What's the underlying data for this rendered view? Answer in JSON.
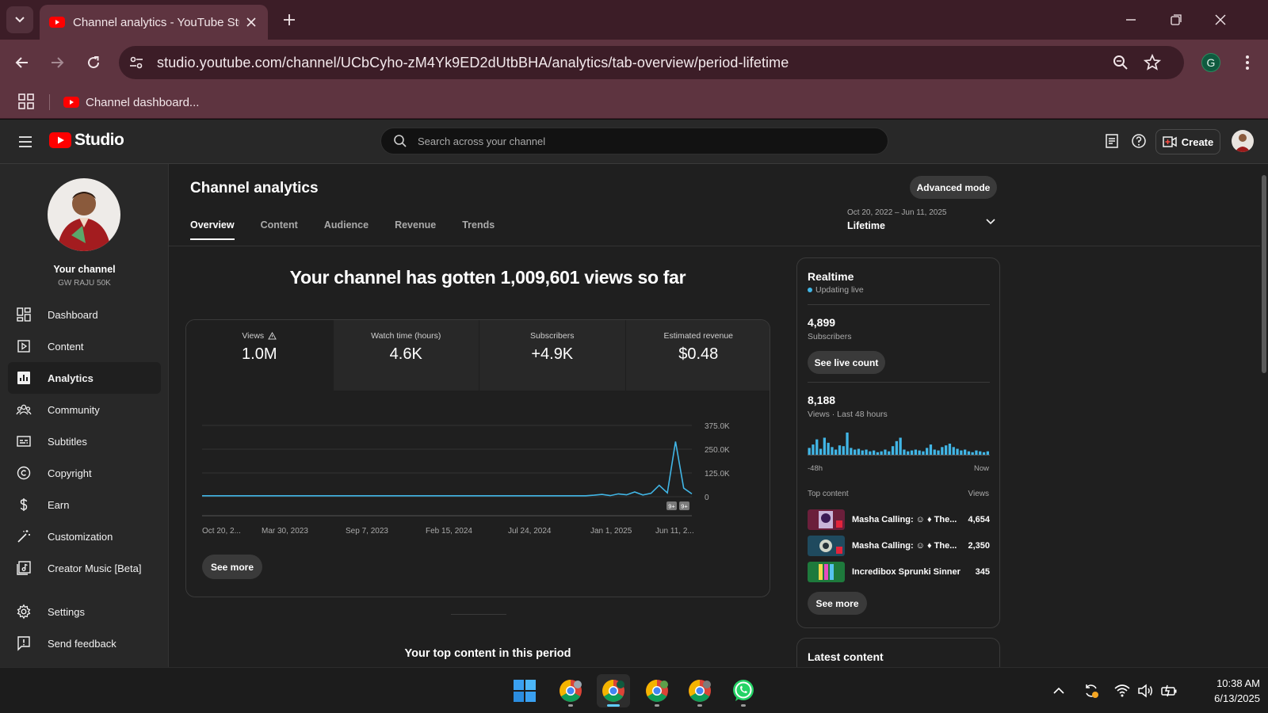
{
  "browser": {
    "tab_title": "Channel analytics - YouTube Studio",
    "url": "studio.youtube.com/channel/UCbCyho-zM4Yk9ED2dUtbBHA/analytics/tab-overview/period-lifetime",
    "profile_initial": "G",
    "bookmark_label": "Channel dashboard..."
  },
  "header": {
    "logo_text": "Studio",
    "search_placeholder": "Search across your channel",
    "create_label": "Create"
  },
  "sidebar": {
    "your_channel": "Your channel",
    "channel_name": "GW RAJU 50K",
    "items": [
      {
        "label": "Dashboard",
        "icon": "dashboard-icon"
      },
      {
        "label": "Content",
        "icon": "content-icon"
      },
      {
        "label": "Analytics",
        "icon": "analytics-icon",
        "active": true
      },
      {
        "label": "Community",
        "icon": "community-icon"
      },
      {
        "label": "Subtitles",
        "icon": "subtitles-icon"
      },
      {
        "label": "Copyright",
        "icon": "copyright-icon"
      },
      {
        "label": "Earn",
        "icon": "earn-icon"
      },
      {
        "label": "Customization",
        "icon": "customization-icon"
      },
      {
        "label": "Creator Music [Beta]",
        "icon": "creator-music-icon"
      },
      {
        "label": "Settings",
        "icon": "settings-icon"
      },
      {
        "label": "Send feedback",
        "icon": "feedback-icon"
      }
    ]
  },
  "main": {
    "title": "Channel analytics",
    "advanced_mode": "Advanced mode",
    "tabs": [
      "Overview",
      "Content",
      "Audience",
      "Revenue",
      "Trends"
    ],
    "period_range": "Oct 20, 2022 – Jun 11, 2025",
    "period_label": "Lifetime",
    "headline": "Your channel has gotten 1,009,601 views so far",
    "metrics": [
      {
        "label": "Views",
        "value": "1.0M"
      },
      {
        "label": "Watch time (hours)",
        "value": "4.6K"
      },
      {
        "label": "Subscribers",
        "value": "+4.9K"
      },
      {
        "label": "Estimated revenue",
        "value": "$0.48"
      }
    ],
    "see_more": "See more",
    "top_content_title": "Your top content in this period"
  },
  "chart_data": {
    "type": "line",
    "series": [
      {
        "name": "Views",
        "values": [
          5,
          5,
          5,
          5,
          5,
          5,
          5,
          5,
          5,
          5,
          5,
          5,
          5,
          5,
          5,
          5,
          5,
          5,
          5,
          5,
          5,
          5,
          5,
          5,
          5,
          5,
          5,
          5,
          5,
          5,
          5,
          5,
          5,
          5,
          5,
          5,
          5,
          5,
          5,
          5,
          5,
          5,
          5,
          5,
          5,
          5,
          5,
          5,
          8,
          12,
          6,
          15,
          10,
          25,
          9,
          18,
          60,
          20,
          290,
          45,
          15
        ]
      }
    ],
    "x_tick_labels": [
      "Oct 20, 2...",
      "Mar 30, 2023",
      "Sep 7, 2023",
      "Feb 15, 2024",
      "Jul 24, 2024",
      "Jan 1, 2025",
      "Jun 11, 2..."
    ],
    "y_tick_labels": [
      "375.0K",
      "250.0K",
      "125.0K",
      "0"
    ],
    "ylim": [
      0,
      375
    ],
    "y_unit": "K",
    "marker_badges": [
      "9+",
      "9+"
    ],
    "line_color": "#41b6e6"
  },
  "realtime": {
    "title": "Realtime",
    "status": "Updating live",
    "subscribers_value": "4,899",
    "subscribers_label": "Subscribers",
    "see_live_count": "See live count",
    "views_value": "8,188",
    "views_label": "Views · Last 48 hours",
    "axis_start": "-48h",
    "axis_end": "Now",
    "bars": [
      8,
      12,
      18,
      7,
      20,
      14,
      9,
      6,
      11,
      10,
      26,
      8,
      6,
      7,
      5,
      6,
      4,
      5,
      3,
      4,
      6,
      4,
      10,
      16,
      20,
      6,
      4,
      5,
      6,
      5,
      4,
      8,
      12,
      6,
      5,
      9,
      11,
      13,
      9,
      7,
      5,
      6,
      4,
      3,
      5,
      4,
      3,
      4
    ],
    "top_content_label": "Top content",
    "views_col_label": "Views",
    "top_content": [
      {
        "title": "Masha Calling: ☺ ♦ The...",
        "views": "4,654"
      },
      {
        "title": "Masha Calling: ☺ ♦ The...",
        "views": "2,350"
      },
      {
        "title": "Incredibox Sprunki Sinner E...",
        "views": "345"
      }
    ],
    "see_more": "See more",
    "latest_content": "Latest content"
  },
  "taskbar": {
    "time": "10:38 AM",
    "date": "6/13/2025"
  },
  "colors": {
    "accent_line": "#41b6e6",
    "youtube_red": "#ff0000",
    "tab_bar": "#3c1d27",
    "toolbar": "#5e3440"
  }
}
